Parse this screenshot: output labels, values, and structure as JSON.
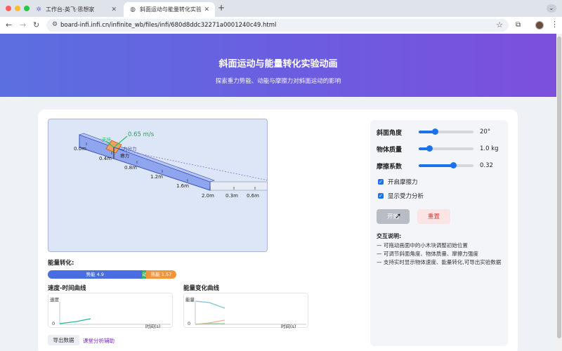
{
  "browser": {
    "tabs": [
      {
        "title": "工作台-英飞·思想家",
        "icon": "app-icon"
      },
      {
        "title": "斜面运动与能量转化实验演示",
        "icon": "globe-icon"
      }
    ],
    "url": "board-infi.infi.cn/infinite_wb/files/infi/680d8ddc32271a0001240c49.html"
  },
  "header": {
    "title": "斜面运动与能量转化实验动画",
    "subtitle": "探索重力势能、动能与摩擦力对斜面运动的影响"
  },
  "simulation": {
    "velocity_label": "0.65 m/s",
    "force_labels": {
      "support": "支持",
      "gravity": "力分力",
      "friction": "擦力"
    },
    "distance_marks": [
      "0.0m",
      "0.4m",
      "0.8m",
      "1.2m",
      "1.6m",
      "2.0m",
      "0.3m",
      "0.6m"
    ]
  },
  "energy": {
    "title": "能量转化:",
    "potential": {
      "label": "势能 4.9",
      "value": 4.9,
      "color": "#4a6ee0"
    },
    "kinetic": {
      "label": "动",
      "value": 0.2,
      "color": "#34b46a"
    },
    "heat": {
      "label": "热能 1.57",
      "value": 1.57,
      "color": "#f5953b"
    }
  },
  "charts": {
    "velocity": {
      "title": "速度-时间曲线",
      "ylabel": "速度",
      "xlabel": "时间(s)",
      "zero": "0"
    },
    "energy": {
      "title": "能量变化曲线",
      "ylabel": "能量",
      "xlabel": "时间(s)",
      "zero": "0"
    }
  },
  "actions": {
    "export": "导出数据",
    "helper": "课堂分析辅助"
  },
  "controls": {
    "angle": {
      "label": "斜面角度",
      "value": "20°",
      "fraction": 0.3
    },
    "mass": {
      "label": "物体质量",
      "value": "1.0 kg",
      "fraction": 0.2
    },
    "friction": {
      "label": "摩擦系数",
      "value": "0.32",
      "fraction": 0.64
    },
    "enable_friction": {
      "label": "开启摩擦力",
      "checked": true
    },
    "show_forces": {
      "label": "显示受力分析",
      "checked": true
    },
    "start_button": "开始",
    "reset_button": "重置"
  },
  "help": {
    "title": "交互说明:",
    "lines": [
      "— 可拖动画面中的小木块调整初始位置",
      "— 可调节斜面角度、物体质量、摩擦力强度",
      "— 支持实时显示物体速度、能量转化,可导出实验数据"
    ]
  }
}
